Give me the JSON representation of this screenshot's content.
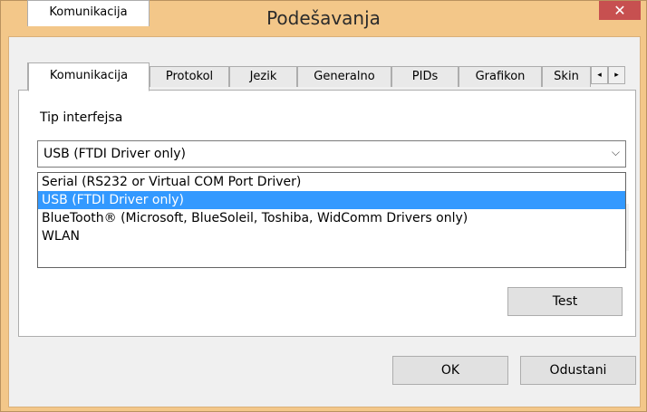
{
  "window": {
    "title": "Podešavanja",
    "close_glyph": "✕"
  },
  "tabs": [
    {
      "label": "Komunikacija",
      "active": true
    },
    {
      "label": "Protokol",
      "active": false
    },
    {
      "label": "Jezik",
      "active": false
    },
    {
      "label": "Generalno",
      "active": false
    },
    {
      "label": "PIDs",
      "active": false
    },
    {
      "label": "Grafikon",
      "active": false
    },
    {
      "label": "Skin",
      "active": false
    }
  ],
  "tab_scroll": {
    "left_glyph": "◂",
    "right_glyph": "▸"
  },
  "interface": {
    "label": "Tip interfejsa",
    "value": "USB (FTDI Driver only)",
    "arrow_glyph": "⌵",
    "options": [
      "Serial (RS232 or Virtual COM Port Driver)",
      "USB (FTDI Driver only)",
      "BlueTooth® (Microsoft, BlueSoleil, Toshiba, WidComm Drivers only)",
      "WLAN"
    ],
    "selected_index": 1
  },
  "buttons": {
    "test": "Test",
    "ok": "OK",
    "cancel": "Odustani"
  },
  "colors": {
    "frame": "#f3c789",
    "close": "#c75050",
    "selection": "#3399ff"
  }
}
